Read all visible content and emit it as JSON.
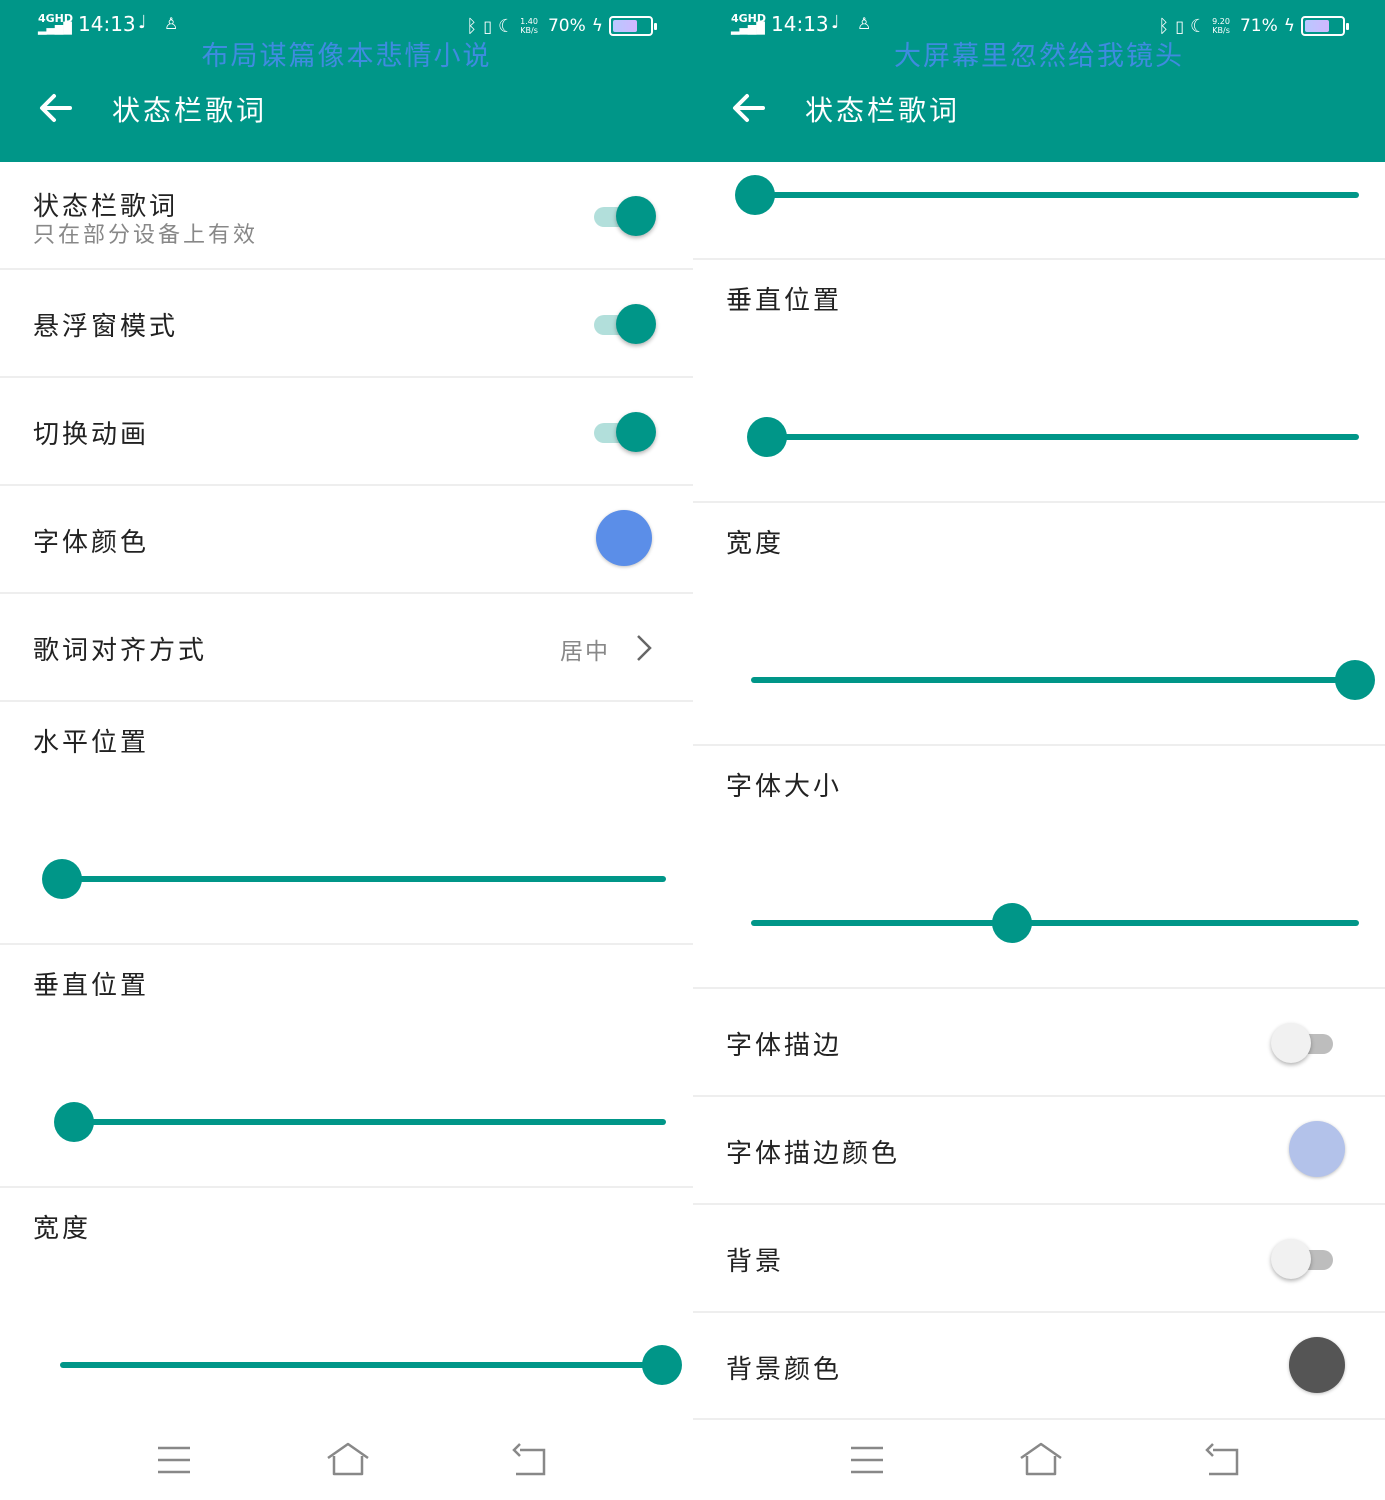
{
  "left": {
    "status": {
      "network": "4GHD",
      "time": "14:13",
      "speed_top": "1.40",
      "speed_bottom": "KB/s",
      "battery_pct": "70%",
      "battery_level": 0.7
    },
    "lyric_overlay": "布局谋篇像本悲情小说",
    "toolbar": {
      "title": "状态栏歌词"
    },
    "rows": {
      "statusbar_lyrics": {
        "title": "状态栏歌词",
        "subtitle": "只在部分设备上有效",
        "on": true
      },
      "float_mode": {
        "title": "悬浮窗模式",
        "on": true
      },
      "switch_anim": {
        "title": "切换动画",
        "on": true
      },
      "font_color": {
        "title": "字体颜色",
        "color": "#5b8ee8"
      },
      "align": {
        "title": "歌词对齐方式",
        "value": "居中"
      },
      "horizontal": {
        "title": "水平位置",
        "level": 0.0
      },
      "vertical": {
        "title": "垂直位置",
        "level": 0.0
      },
      "width": {
        "title": "宽度",
        "level": 1.0
      }
    }
  },
  "right": {
    "status": {
      "network": "4GHD",
      "time": "14:13",
      "speed_top": "9.20",
      "speed_bottom": "KB/s",
      "battery_pct": "71%",
      "battery_level": 0.71
    },
    "lyric_overlay": "大屏幕里忽然给我镜头",
    "toolbar": {
      "title": "状态栏歌词"
    },
    "rows": {
      "top_slider": {
        "level": 0.0
      },
      "vertical": {
        "title": "垂直位置",
        "level": 0.0
      },
      "width": {
        "title": "宽度",
        "level": 1.0
      },
      "font_size": {
        "title": "字体大小",
        "level": 0.43
      },
      "stroke": {
        "title": "字体描边",
        "on": false
      },
      "stroke_color": {
        "title": "字体描边颜色",
        "color": "#b3c2ea"
      },
      "background": {
        "title": "背景",
        "on": false
      },
      "background_color": {
        "title": "背景颜色",
        "color": "#555555"
      }
    }
  },
  "colors": {
    "primary": "#009688",
    "primary_light": "#b2dfdb",
    "lyric_overlay": "#3f8be0"
  },
  "icons": [
    "back-arrow-icon",
    "chevron-right-icon",
    "menu-icon",
    "home-icon",
    "back-nav-icon",
    "bluetooth-icon",
    "vibrate-icon",
    "moon-icon",
    "music-note-icon",
    "battery-icon",
    "charging-bolt-icon"
  ]
}
